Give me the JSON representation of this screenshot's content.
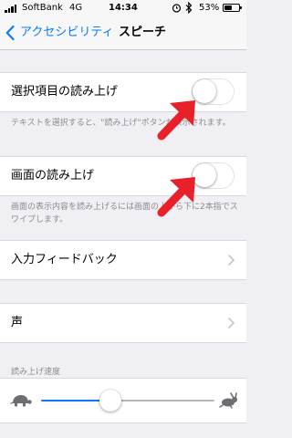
{
  "status_bar": {
    "carrier": "SoftBank",
    "network": "4G",
    "time": "14:34",
    "battery_percent": "53%",
    "battery_level": 0.53,
    "icons": [
      "signal-icon",
      "alarm-icon",
      "bluetooth-icon",
      "battery-icon"
    ]
  },
  "nav": {
    "back_label": "アクセシビリティ",
    "title": "スピーチ"
  },
  "speak_selection": {
    "label": "選択項目の読み上げ",
    "enabled": false,
    "footer": "テキストを選択すると、\"読み上げ\"ボタンが表示されます。"
  },
  "speak_screen": {
    "label": "画面の読み上げ",
    "enabled": false,
    "footer": "画面の表示内容を読み上げるには画面の上から下に2本指でスワイプします。"
  },
  "typing_feedback": {
    "label": "入力フィードバック"
  },
  "voices": {
    "label": "声"
  },
  "speaking_rate": {
    "header": "読み上げ速度",
    "value": 0.4,
    "min_icon": "tortoise-icon",
    "max_icon": "hare-icon"
  },
  "colors": {
    "accent": "#0a7bff",
    "arrow": "#e8202a",
    "background": "#efeff4"
  }
}
